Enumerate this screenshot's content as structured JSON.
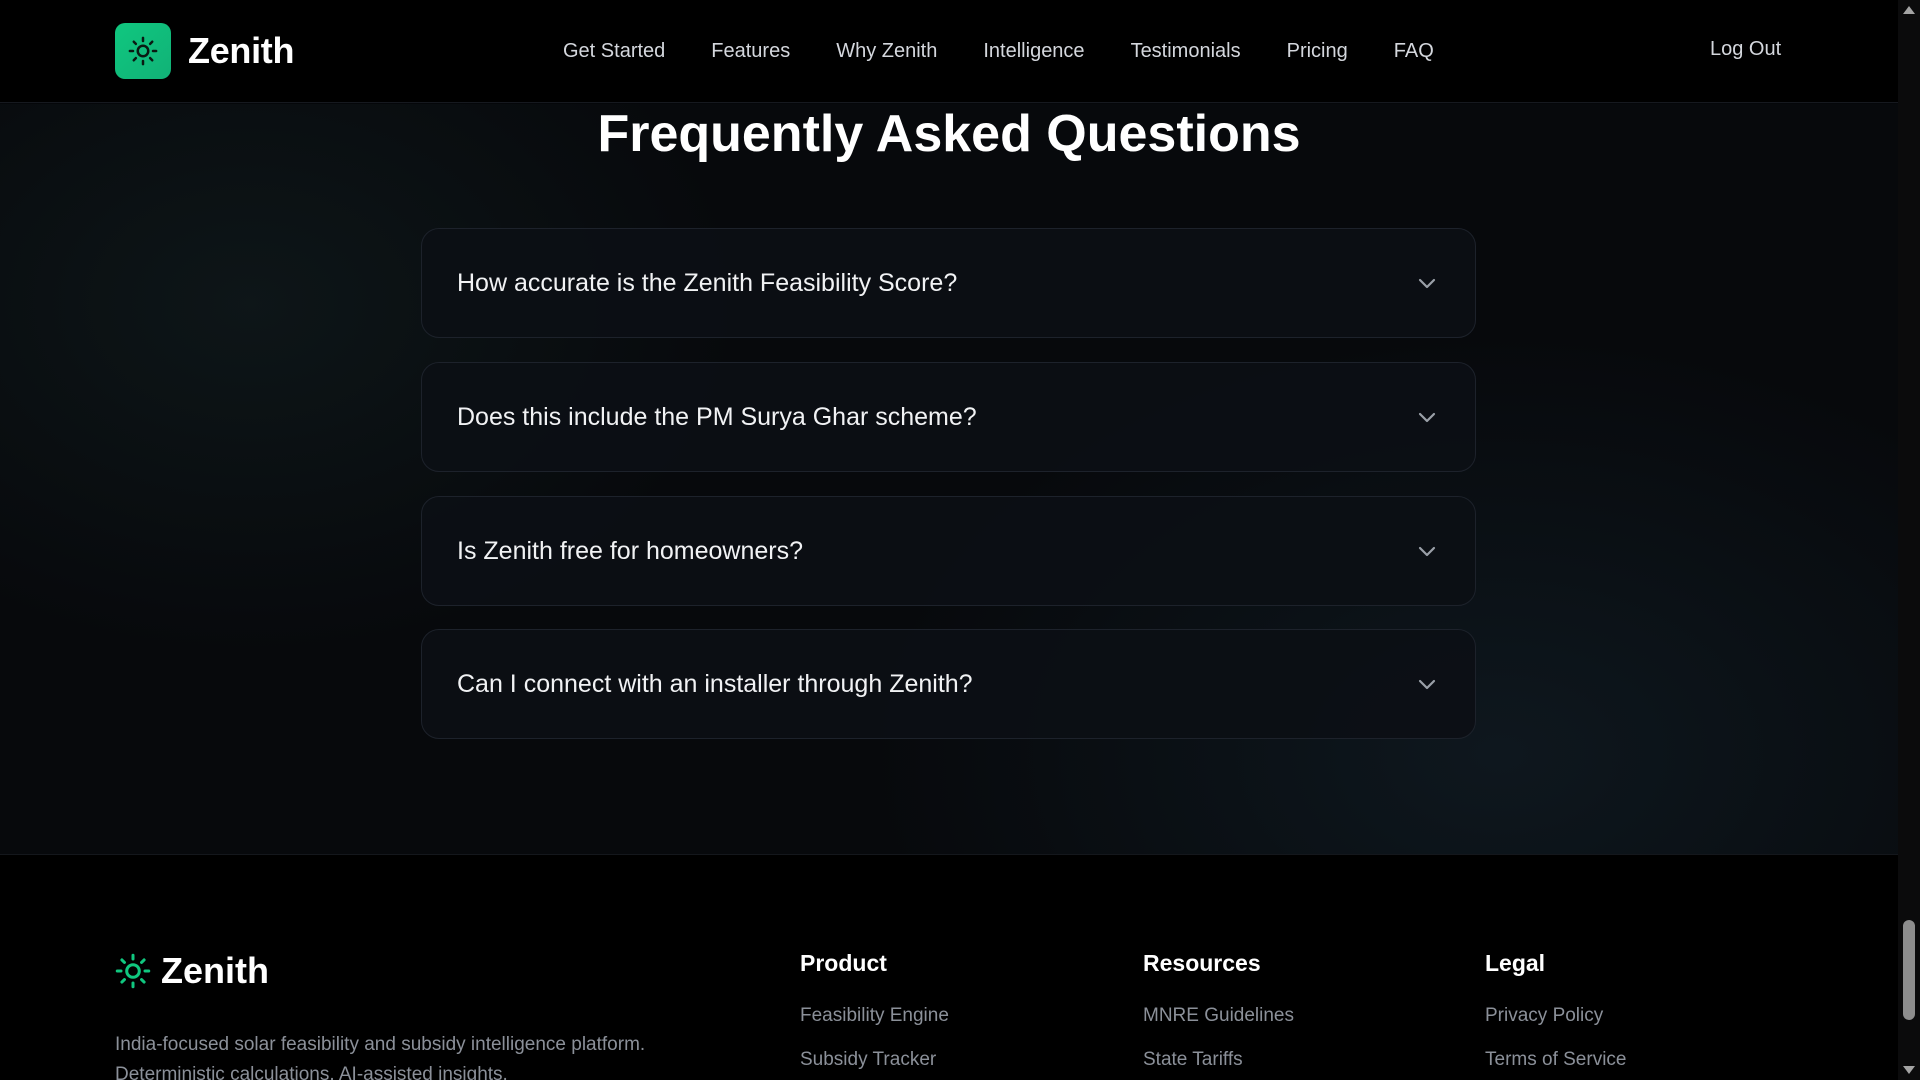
{
  "header": {
    "brand": "Zenith",
    "nav": [
      "Get Started",
      "Features",
      "Why Zenith",
      "Intelligence",
      "Testimonials",
      "Pricing",
      "FAQ"
    ],
    "logout": "Log Out"
  },
  "faq": {
    "title": "Frequently Asked Questions",
    "items": [
      "How accurate is the Zenith Feasibility Score?",
      "Does this include the PM Surya Ghar scheme?",
      "Is Zenith free for homeowners?",
      "Can I connect with an installer through Zenith?"
    ]
  },
  "footer": {
    "brand": "Zenith",
    "description": "India-focused solar feasibility and subsidy intelligence platform. Deterministic calculations. AI-assisted insights.",
    "columns": [
      {
        "title": "Product",
        "links": [
          "Feasibility Engine",
          "Subsidy Tracker"
        ]
      },
      {
        "title": "Resources",
        "links": [
          "MNRE Guidelines",
          "State Tariffs"
        ]
      },
      {
        "title": "Legal",
        "links": [
          "Privacy Policy",
          "Terms of Service"
        ]
      }
    ]
  },
  "colors": {
    "accent": "#10c77f",
    "background": "#05070a",
    "muted_text": "#8b9099"
  },
  "icons": {
    "brand": "sun-icon",
    "faq_toggle": "chevron-down-icon"
  }
}
